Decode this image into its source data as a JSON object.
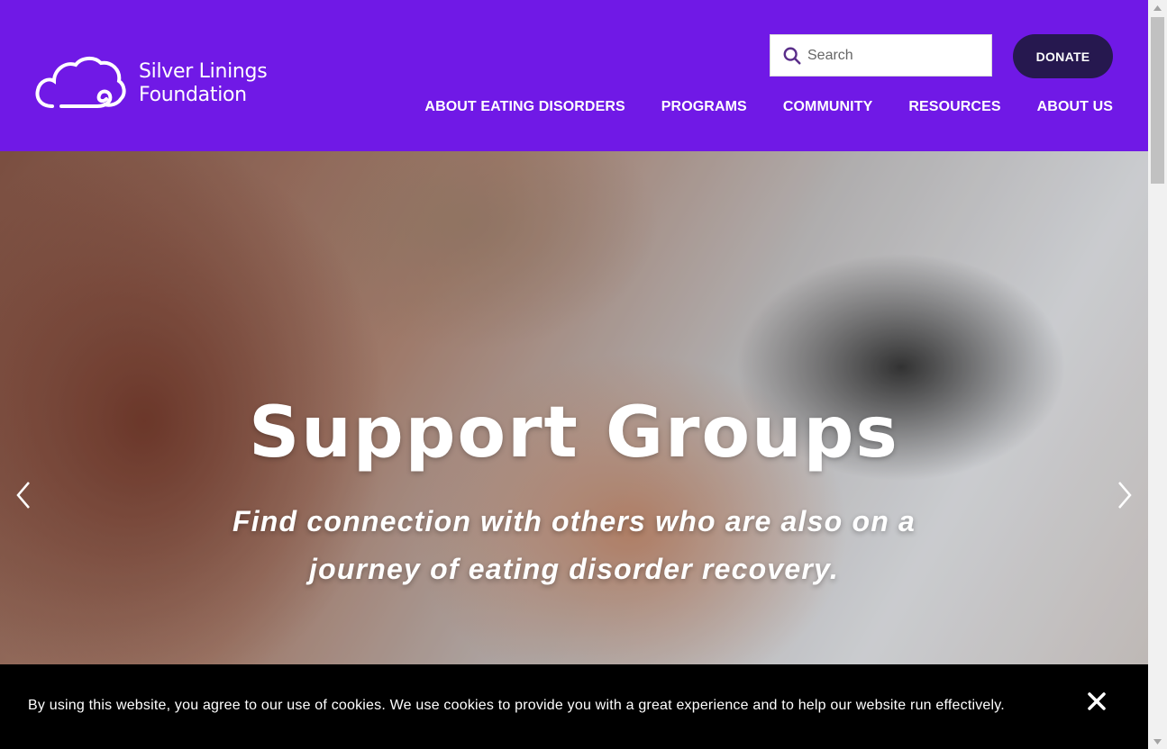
{
  "brand": {
    "name_line1": "Silver Linings",
    "name_line2": "Foundation",
    "logo_icon": "cloud-icon"
  },
  "search": {
    "placeholder": "Search",
    "icon": "search-icon"
  },
  "donate_label": "DONATE",
  "nav": {
    "items": [
      {
        "label": "ABOUT EATING DISORDERS"
      },
      {
        "label": "PROGRAMS"
      },
      {
        "label": "COMMUNITY"
      },
      {
        "label": "RESOURCES"
      },
      {
        "label": "ABOUT US"
      }
    ]
  },
  "hero": {
    "title": "Support Groups",
    "subtitle": "Find connection with others who are also on a journey of eating disorder recovery.",
    "prev_icon": "chevron-left-icon",
    "next_icon": "chevron-right-icon"
  },
  "cookie_banner": {
    "text": "By using this website, you agree to our use of cookies. We use cookies to provide you with a great experience and to help our website run effectively.",
    "close_icon": "close-icon"
  },
  "colors": {
    "header_bg": "#7019e6",
    "donate_bg": "#26184f",
    "cookie_bg": "#000000"
  }
}
